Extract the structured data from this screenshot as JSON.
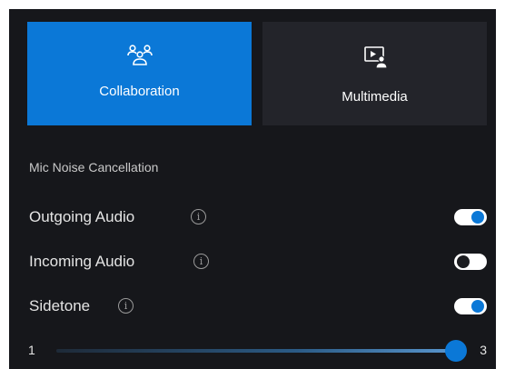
{
  "tabs": [
    {
      "label": "Collaboration",
      "icon": "people-group-icon",
      "active": true
    },
    {
      "label": "Multimedia",
      "icon": "media-presenter-icon",
      "active": false
    }
  ],
  "section": {
    "title": "Mic Noise Cancellation"
  },
  "settings": [
    {
      "label": "Outgoing Audio",
      "info_icon": "i",
      "enabled": true
    },
    {
      "label": "Incoming Audio",
      "info_icon": "i",
      "enabled": false
    },
    {
      "label": "Sidetone",
      "info_icon": "i",
      "enabled": true
    }
  ],
  "sidetone_slider": {
    "min_label": "1",
    "max_label": "3",
    "value": 3
  },
  "colors": {
    "accent": "#0b78d7",
    "panel_background": "#16171b",
    "inactive_tab": "#23242a"
  }
}
